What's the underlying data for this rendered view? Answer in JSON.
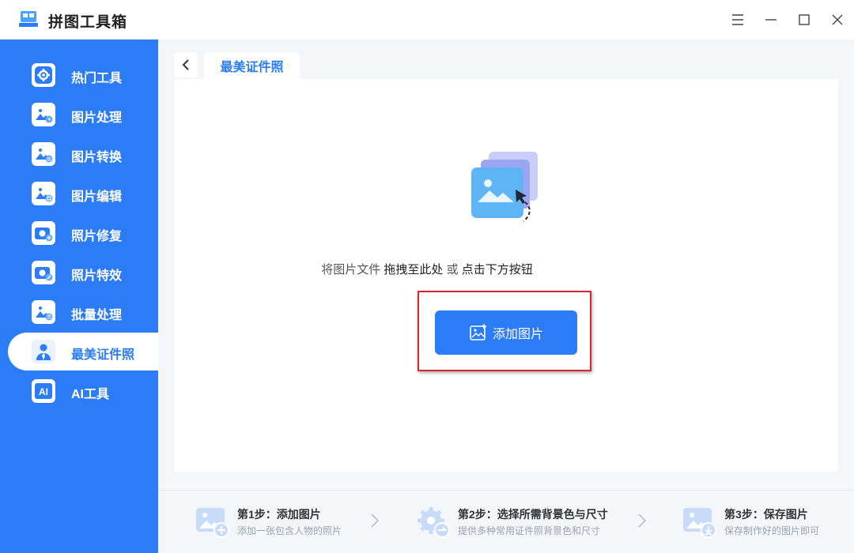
{
  "app": {
    "title": "拼图工具箱"
  },
  "window": {
    "menu_icon": "menu-icon",
    "minimize_icon": "minimize-icon",
    "maximize_icon": "maximize-icon",
    "close_icon": "close-icon"
  },
  "sidebar": {
    "items": [
      {
        "label": "热门工具",
        "icon": "gear-icon"
      },
      {
        "label": "图片处理",
        "icon": "image-clock-icon"
      },
      {
        "label": "图片转换",
        "icon": "image-convert-icon"
      },
      {
        "label": "图片编辑",
        "icon": "image-edit-icon"
      },
      {
        "label": "照片修复",
        "icon": "camera-plus-icon"
      },
      {
        "label": "照片特效",
        "icon": "camera-wand-icon"
      },
      {
        "label": "批量处理",
        "icon": "image-batch-icon"
      },
      {
        "label": "最美证件照",
        "icon": "id-photo-icon"
      },
      {
        "label": "AI工具",
        "icon": "ai-icon"
      }
    ],
    "active_index": 7
  },
  "main": {
    "tab_label": "最美证件照",
    "hint_prefix": "将图片文件 ",
    "hint_drag": "拖拽至此处",
    "hint_or": " 或 ",
    "hint_click": "点击下方按钮",
    "add_button_label": "添加图片"
  },
  "steps": [
    {
      "title": "第1步：添加图片",
      "desc": "添加一张包含人物的照片"
    },
    {
      "title": "第2步：选择所需背景色与尺寸",
      "desc": "提供多种常用证件照背景色和尺寸"
    },
    {
      "title": "第3步：保存图片",
      "desc": "保存制作好的图片即可"
    }
  ],
  "colors": {
    "accent": "#2b7cf6",
    "highlight": "#d9262b"
  }
}
